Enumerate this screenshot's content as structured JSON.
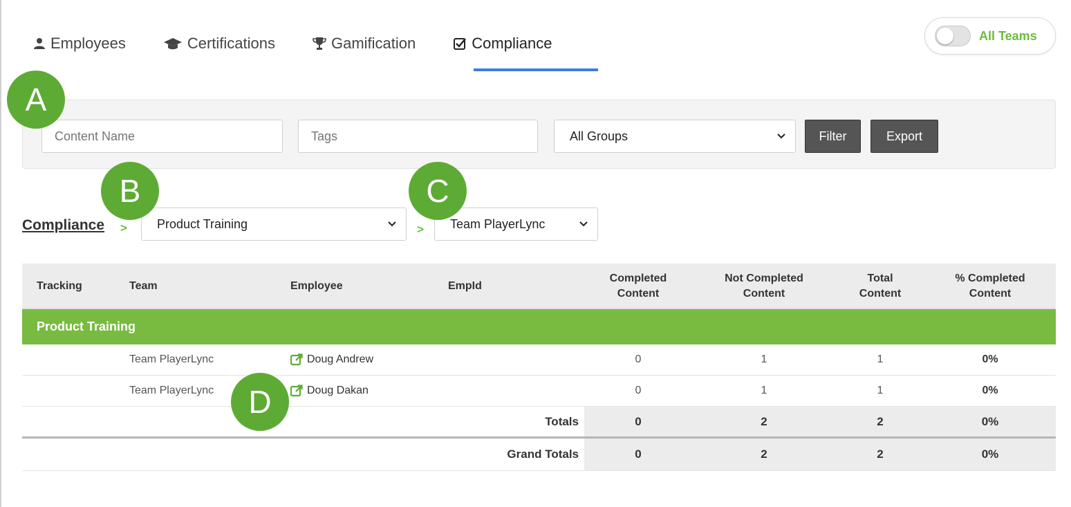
{
  "tabs": [
    {
      "label": "Employees",
      "icon": "user-icon"
    },
    {
      "label": "Certifications",
      "icon": "graduation-cap-icon"
    },
    {
      "label": "Gamification",
      "icon": "trophy-icon"
    },
    {
      "label": "Compliance",
      "icon": "checkbox-icon",
      "active": true
    }
  ],
  "team_toggle": {
    "label": "All Teams",
    "on": false
  },
  "filters": {
    "content_name_placeholder": "Content Name",
    "tags_placeholder": "Tags",
    "group_select_value": "All Groups",
    "filter_label": "Filter",
    "export_label": "Export"
  },
  "markers": {
    "a": "A",
    "b": "B",
    "c": "C",
    "d": "D"
  },
  "breadcrumb": {
    "root": "Compliance",
    "separator": ">",
    "content_select_value": "Product Training",
    "team_select_value": "Team PlayerLync"
  },
  "table": {
    "headers": {
      "tracking": "Tracking",
      "team": "Team",
      "employee": "Employee",
      "empid": "EmpId",
      "completed_1": "Completed",
      "completed_2": "Content",
      "not_completed_1": "Not Completed",
      "not_completed_2": "Content",
      "total_1": "Total",
      "total_2": "Content",
      "pct_1": "% Completed",
      "pct_2": "Content"
    },
    "group": "Product Training",
    "rows": [
      {
        "tracking": "",
        "team": "Team PlayerLync",
        "employee": "Doug Andrew",
        "empid": "",
        "completed": "0",
        "not_completed": "1",
        "total": "1",
        "pct": "0%"
      },
      {
        "tracking": "",
        "team": "Team PlayerLync",
        "employee": "Doug Dakan",
        "empid": "",
        "completed": "0",
        "not_completed": "1",
        "total": "1",
        "pct": "0%"
      }
    ],
    "totals": {
      "label": "Totals",
      "completed": "0",
      "not_completed": "2",
      "total": "2",
      "pct": "0%"
    },
    "grand_totals": {
      "label": "Grand Totals",
      "completed": "0",
      "not_completed": "2",
      "total": "2",
      "pct": "0%"
    }
  },
  "colors": {
    "accent_green": "#78bb40",
    "tab_underline": "#3b7ddd",
    "button_dark": "#555555"
  }
}
